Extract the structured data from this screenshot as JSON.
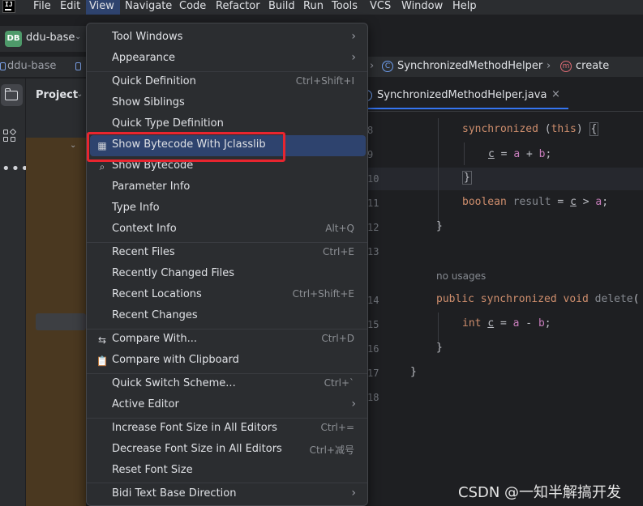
{
  "menubar": {
    "items": [
      {
        "label": "File",
        "mnemonic": "F"
      },
      {
        "label": "Edit",
        "mnemonic": "E"
      },
      {
        "label": "View",
        "mnemonic": "V"
      },
      {
        "label": "Navigate",
        "mnemonic": "N"
      },
      {
        "label": "Code",
        "mnemonic": "C"
      },
      {
        "label": "Refactor",
        "mnemonic": "R"
      },
      {
        "label": "Build",
        "mnemonic": "B"
      },
      {
        "label": "Run",
        "mnemonic": "u"
      },
      {
        "label": "Tools",
        "mnemonic": "T"
      },
      {
        "label": "VCS",
        "mnemonic": "S"
      },
      {
        "label": "Window",
        "mnemonic": "W"
      },
      {
        "label": "Help",
        "mnemonic": "H"
      }
    ],
    "active": "View",
    "app_logo": "IJ"
  },
  "toolbar": {
    "project_badge": "DB",
    "project_name": "ddu-base"
  },
  "breadcrumb": {
    "root": "ddu-base",
    "class_name": "SynchronizedMethodHelper",
    "method_name": "create"
  },
  "project_panel": {
    "title": "Project"
  },
  "editor": {
    "tab_label": "SynchronizedMethodHelper.java",
    "line_numbers": [
      "8",
      "9",
      "10",
      "11",
      "12",
      "13",
      "14",
      "15",
      "16",
      "17",
      "18"
    ],
    "hint_no_usages": "no usages"
  },
  "view_menu": {
    "items": [
      {
        "label": "Tool Windows",
        "shortcut": "",
        "submenu": true,
        "icon": ""
      },
      {
        "label": "Appearance",
        "shortcut": "",
        "submenu": true,
        "icon": ""
      },
      {
        "label": "Quick Definition",
        "shortcut": "Ctrl+Shift+I",
        "submenu": false,
        "icon": ""
      },
      {
        "label": "Show Siblings",
        "shortcut": "",
        "submenu": false,
        "icon": ""
      },
      {
        "label": "Quick Type Definition",
        "shortcut": "",
        "submenu": false,
        "icon": ""
      },
      {
        "label": "Show Bytecode With Jclasslib",
        "shortcut": "",
        "submenu": false,
        "icon": "bytecode-table-icon"
      },
      {
        "label": "Show Bytecode",
        "shortcut": "",
        "submenu": false,
        "icon": "search-bytecode-icon"
      },
      {
        "label": "Parameter Info",
        "shortcut": "",
        "submenu": false,
        "icon": ""
      },
      {
        "label": "Type Info",
        "shortcut": "",
        "submenu": false,
        "icon": ""
      },
      {
        "label": "Context Info",
        "shortcut": "Alt+Q",
        "submenu": false,
        "icon": ""
      },
      {
        "label": "Recent Files",
        "shortcut": "Ctrl+E",
        "submenu": false,
        "icon": ""
      },
      {
        "label": "Recently Changed Files",
        "shortcut": "",
        "submenu": false,
        "icon": ""
      },
      {
        "label": "Recent Locations",
        "shortcut": "Ctrl+Shift+E",
        "submenu": false,
        "icon": ""
      },
      {
        "label": "Recent Changes",
        "shortcut": "",
        "submenu": false,
        "icon": ""
      },
      {
        "label": "Compare With...",
        "shortcut": "Ctrl+D",
        "submenu": false,
        "icon": "compare-icon"
      },
      {
        "label": "Compare with Clipboard",
        "shortcut": "",
        "submenu": false,
        "icon": "clipboard-icon"
      },
      {
        "label": "Quick Switch Scheme...",
        "shortcut": "Ctrl+`",
        "submenu": false,
        "icon": ""
      },
      {
        "label": "Active Editor",
        "shortcut": "",
        "submenu": true,
        "icon": ""
      },
      {
        "label": "Increase Font Size in All Editors",
        "shortcut": "Ctrl+=",
        "submenu": false,
        "icon": ""
      },
      {
        "label": "Decrease Font Size in All Editors",
        "shortcut": "Ctrl+减号",
        "submenu": false,
        "icon": ""
      },
      {
        "label": "Reset Font Size",
        "shortcut": "",
        "submenu": false,
        "icon": ""
      },
      {
        "label": "Bidi Text Base Direction",
        "shortcut": "",
        "submenu": true,
        "icon": ""
      }
    ],
    "selected": "Show Bytecode With Jclasslib"
  },
  "colors": {
    "menu_selection": "#2e436e",
    "highlight_box": "#e8252f",
    "keyword": "#cf8e6d",
    "field": "#c77dbb"
  },
  "watermark": "CSDN @一知半解搞开发"
}
